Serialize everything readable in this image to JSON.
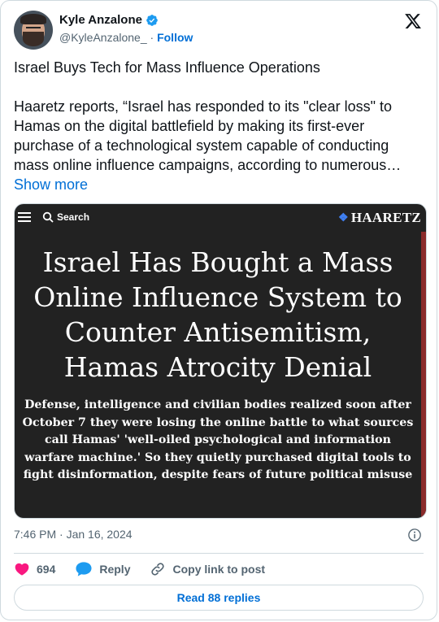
{
  "author": {
    "name": "Kyle Anzalone",
    "handle": "@KyleAnzalone_",
    "separator": "·",
    "follow_label": "Follow"
  },
  "tweet": {
    "text": "Israel Buys Tech for Mass Influence Operations\n\nHaaretz reports, “Israel has responded to its \"clear loss\" to Hamas on the digital battlefield by making its first-ever purchase of a technological system capable of conducting mass online influence campaigns, according to numerous…",
    "show_more": "Show more",
    "timestamp": "7:46 PM · Jan 16, 2024"
  },
  "media": {
    "search_label": "Search",
    "brand": "HAARETZ",
    "headline": "Israel Has Bought a Mass Online Influence System to Counter Antisemitism, Hamas Atrocity Denial",
    "subhead": "Defense, intelligence and civilian bodies realized soon after October 7 they were losing the online battle to what sources call Hamas' 'well-oiled psychological and information warfare machine.' So they quietly purchased digital tools to fight disinformation, despite fears of future political misuse"
  },
  "actions": {
    "like_count": "694",
    "reply_label": "Reply",
    "copy_label": "Copy link to post"
  },
  "replies_label": "Read 88 replies",
  "colors": {
    "link": "#006fd6",
    "like": "#f91880",
    "verified": "#1d9bf0",
    "media_bg": "#222222",
    "muted": "#536471"
  }
}
